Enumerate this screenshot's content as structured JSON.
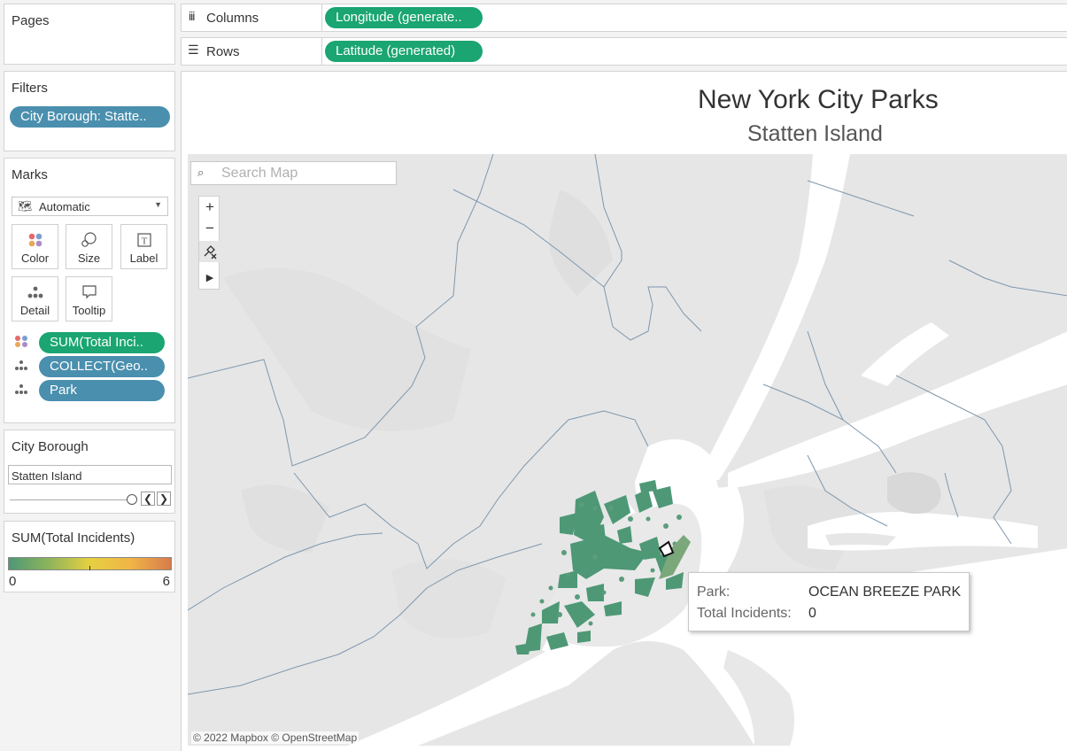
{
  "sidebar": {
    "pages": {
      "title": "Pages"
    },
    "filters": {
      "title": "Filters",
      "pill": "City Borough: Statte.."
    },
    "marks": {
      "title": "Marks",
      "type_dropdown": "Automatic",
      "buttons": {
        "color": "Color",
        "size": "Size",
        "label": "Label",
        "detail": "Detail",
        "tooltip": "Tooltip"
      },
      "pills": [
        "SUM(Total Inci..",
        "COLLECT(Geo..",
        "Park"
      ]
    },
    "city_borough": {
      "title": "City Borough",
      "value": "Statten Island"
    },
    "legend": {
      "title": "SUM(Total Incidents)",
      "min": "0",
      "max": "6"
    }
  },
  "shelves": {
    "columns_label": "Columns",
    "columns_pill": "Longitude (generate..",
    "rows_label": "Rows",
    "rows_pill": "Latitude (generated)"
  },
  "view": {
    "title": "New York City Parks",
    "subtitle": "Statten Island",
    "search_placeholder": "Search Map",
    "attribution": "© 2022 Mapbox © OpenStreetMap",
    "tooltip": {
      "park_label": "Park:",
      "park_value": "OCEAN BREEZE PARK",
      "incidents_label": "Total Incidents:",
      "incidents_value": "0"
    }
  },
  "colors": {
    "green_pill": "#1aa572",
    "blue_pill": "#4a8fae",
    "park_fill": "#4e9876",
    "water": "#ffffff",
    "land": "#e8e8e8"
  }
}
